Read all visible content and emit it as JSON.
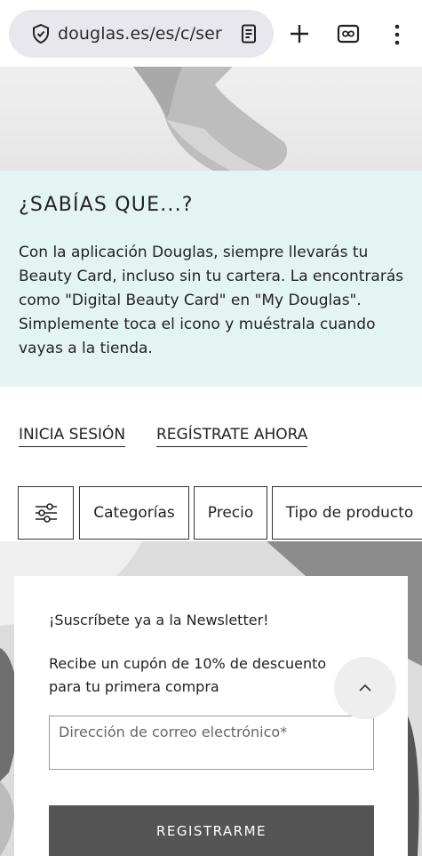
{
  "browser": {
    "url": "douglas.es/es/c/ser",
    "icons": [
      "shield-icon",
      "reader-mode-icon",
      "new-tab-plus-icon",
      "tab-switcher-icon",
      "more-vert-icon"
    ]
  },
  "info": {
    "title": "¿SABÍAS QUE...?",
    "body": "Con la aplicación Douglas, siempre llevarás tu Beauty Card, incluso sin tu cartera. La encontrarás como \"Digital Beauty Card\" en \"My Douglas\". Simplemente toca el icono y muéstrala cuando vayas a la tienda."
  },
  "auth": {
    "login": "INICIA SESIÓN",
    "register": "REGÍSTRATE AHORA"
  },
  "filters": {
    "categories": "Categorías",
    "price": "Precio",
    "product_type": "Tipo de producto"
  },
  "newsletter": {
    "title": "¡Suscríbete ya a la Newsletter!",
    "description": "Recibe un cupón de 10% de descuento para tu primera compra",
    "email_placeholder": "Dirección de correo electrónico*",
    "email_value": "",
    "submit": "REGISTRARME"
  },
  "colors": {
    "info_bg": "#e4f4f2",
    "submit_bg": "#555555"
  }
}
